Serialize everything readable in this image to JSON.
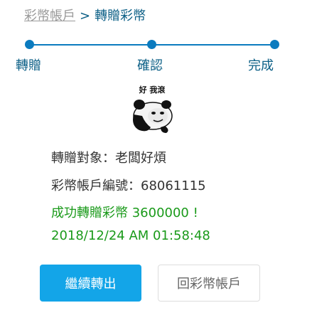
{
  "breadcrumb": {
    "parent": "彩幣帳戶",
    "separator": ">",
    "current": "轉贈彩幣"
  },
  "steps": [
    {
      "label": "轉贈"
    },
    {
      "label": "確認"
    },
    {
      "label": "完成"
    }
  ],
  "meme": {
    "caption": "好 我滾",
    "icon": "panda-meme-sticker"
  },
  "result": {
    "recipient": "轉贈對象：老闆好煩",
    "account": "彩幣帳戶編號：68061115",
    "success_message": "成功轉贈彩幣 3600000 !",
    "timestamp": "2018/12/24 AM 01:58:48"
  },
  "actions": {
    "continue_label": "繼續轉出",
    "back_label": "回彩幣帳戶"
  },
  "colors": {
    "accent": "#0b7bbf",
    "button_primary": "#13a5e8",
    "success": "#1a9a1a"
  }
}
